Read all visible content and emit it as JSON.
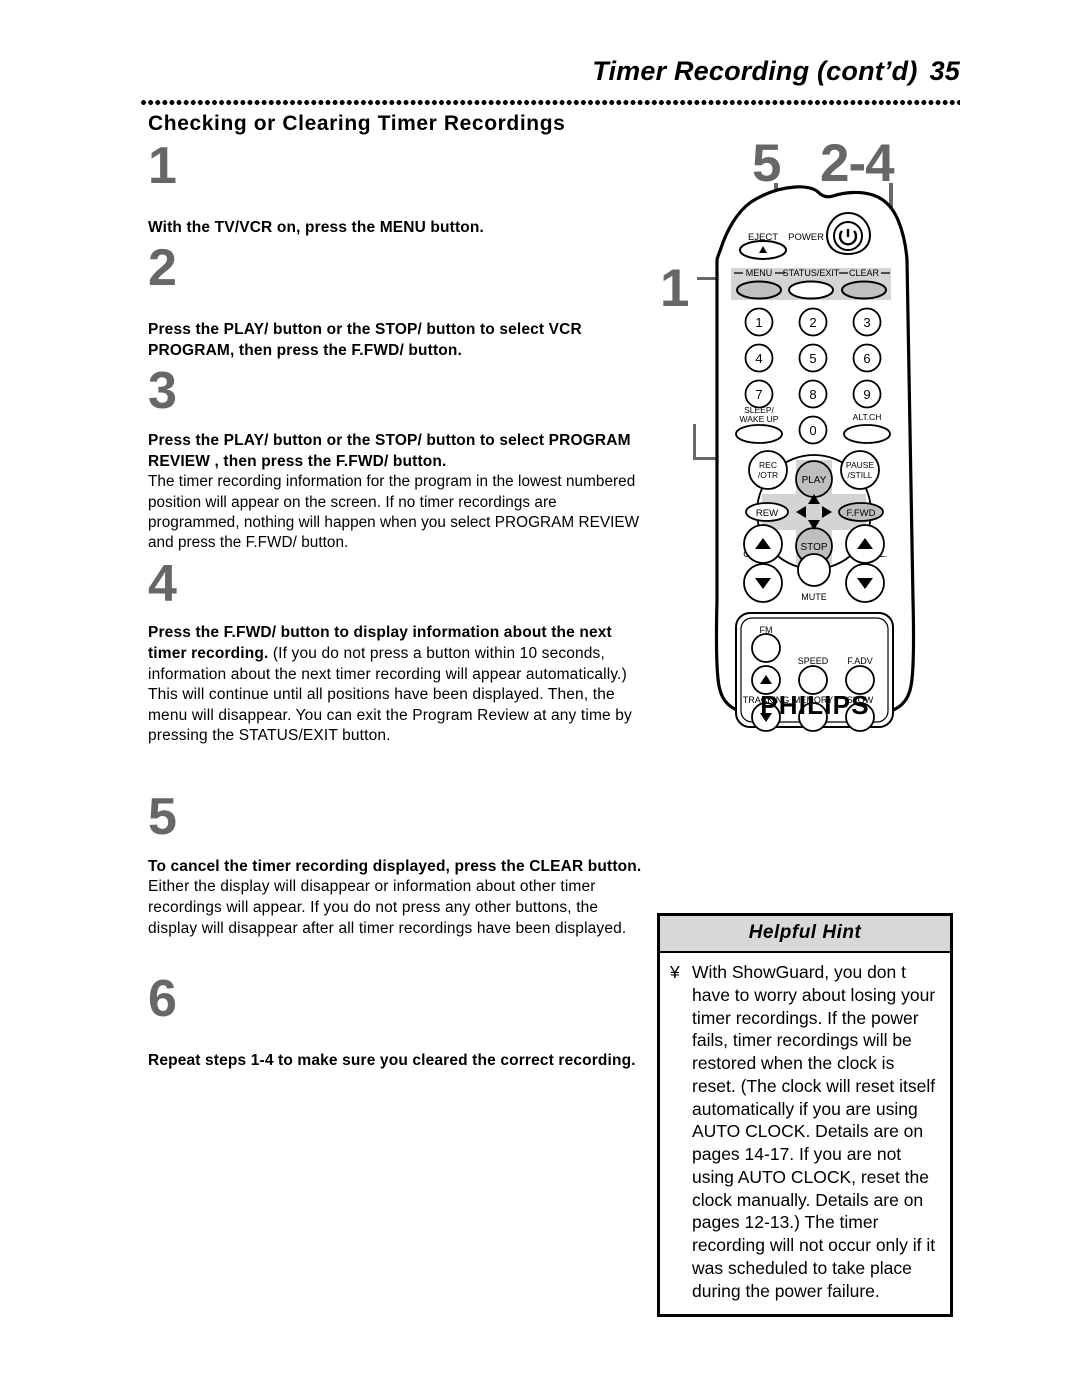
{
  "header": {
    "title": "Timer Recording (cont’d)",
    "page_number": "35"
  },
  "section": {
    "title": "Checking or Clearing Timer Recordings"
  },
  "steps": [
    {
      "number": "1",
      "lead": "With the TV/VCR on, press the MENU button.",
      "body": ""
    },
    {
      "number": "2",
      "lead": "Press the PLAY/    button or the STOP/    button to select VCR PROGRAM, then press the F.FWD/    button.",
      "body": ""
    },
    {
      "number": "3",
      "lead": "Press the PLAY/    button or the STOP/    button to select PROGRAM REVIEW , then press the F.FWD/    button.",
      "body": "The timer recording information for the program in the lowest numbered position will appear on the screen. If no timer recordings are programmed, nothing will happen when you select PROGRAM REVIEW and press the F.FWD/    button."
    },
    {
      "number": "4",
      "lead": "Press the F.FWD/    button to display information about the next timer recording.",
      "body": "(If you do not press a button within 10 seconds, information about the next timer recording will appear automatically.) This will continue until all positions have been displayed. Then, the menu will disappear. You can exit the Program Review at any time by pressing the STATUS/EXIT button."
    },
    {
      "number": "5",
      "lead": "To cancel the timer recording displayed, press the CLEAR button.",
      "body": "Either the display will disappear or information about other timer recordings will appear. If you do not press any other buttons, the display will disappear after all timer recordings have been displayed."
    },
    {
      "number": "6",
      "lead": "Repeat steps 1-4 to make sure you cleared the correct recording.",
      "body": ""
    }
  ],
  "callouts": {
    "top_left": "5",
    "top_right": "2-4",
    "side_left": "1"
  },
  "remote": {
    "brand": "PHILIPS",
    "buttons": {
      "eject": "EJECT",
      "power": "POWER",
      "menu": "MENU",
      "status_exit": "STATUS/EXIT",
      "clear": "CLEAR",
      "keypad": [
        "1",
        "2",
        "3",
        "4",
        "5",
        "6",
        "7",
        "8",
        "9"
      ],
      "sleep_wakeup_line1": "SLEEP/",
      "sleep_wakeup_line2": "WAKE UP",
      "zero": "0",
      "alt_ch": "ALT.CH",
      "rec_otr_line1": "REC",
      "rec_otr_line2": "/OTR",
      "pause_still_line1": "PAUSE",
      "pause_still_line2": "/STILL",
      "play": "PLAY",
      "rew": "REW",
      "ffwd": "F.FWD",
      "stop": "STOP",
      "ch": "CH.",
      "vol": "VOL.",
      "mute": "MUTE",
      "fm": "FM",
      "speed": "SPEED",
      "f_adv": "F.ADV",
      "tracking": "TRACKING",
      "memory": "MEMORY",
      "slow": "SLOW"
    }
  },
  "hint": {
    "title": "Helpful Hint",
    "bullet": "¥",
    "text": "With ShowGuard, you don t have to worry about losing your timer recordings. If the power fails, timer recordings will be restored when the clock is reset. (The clock will reset itself automatically if you are using AUTO CLOCK. Details are on pages 14-17.  If you are not using AUTO CLOCK, reset the clock manually. Details are on pages 12-13.) The timer recording will not occur only if it was scheduled to take place during the power failure."
  },
  "colors": {
    "step_number": "#676767",
    "hint_header_bg": "#d8d8d8",
    "button_fill": "#bfbfbf",
    "panel_fill": "#d4d4d4"
  }
}
